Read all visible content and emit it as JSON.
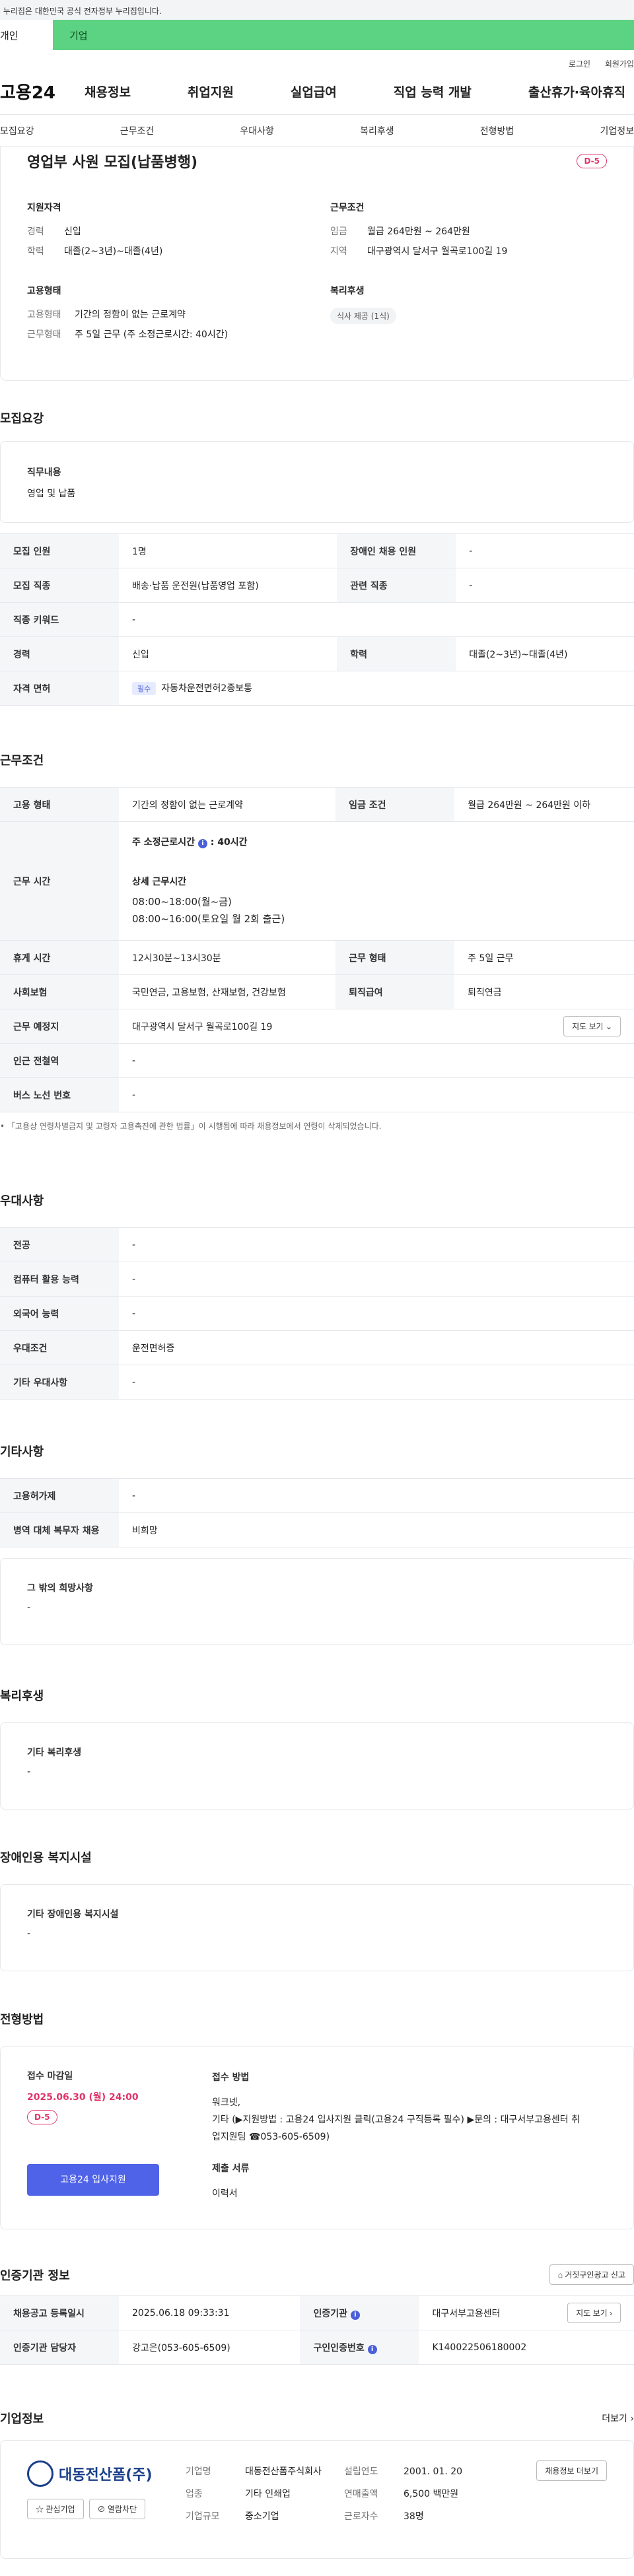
{
  "gov_banner": "이 누리집은 대한민국 공식 전자정부 누리집입니다.",
  "site_tabs": [
    "개인",
    "기업"
  ],
  "util_links": [
    "로그인",
    "회원가입"
  ],
  "logo": "고용24",
  "gnb": [
    "채용정보",
    "취업지원",
    "실업급여",
    "직업 능력 개발",
    "출산휴가·육아휴직"
  ],
  "anchor_tabs": [
    "모집요강",
    "근무조건",
    "우대사항",
    "복리후생",
    "전형방법",
    "기업정보"
  ],
  "summary": {
    "title": "영업부 사원 모집(납품병행)",
    "dday": "D-5",
    "qualify_h": "지원자격",
    "qualify": [
      {
        "k": "경력",
        "v": "신입"
      },
      {
        "k": "학력",
        "v": "대졸(2~3년)~대졸(4년)"
      }
    ],
    "cond_h": "근무조건",
    "cond": [
      {
        "k": "임금",
        "v": "월급 264만원 ~ 264만원"
      },
      {
        "k": "지역",
        "v": "대구광역시 달서구 월곡로100길 19"
      }
    ],
    "emp_h": "고용형태",
    "emp": [
      {
        "k": "고용형태",
        "v": "기간의 정함이 없는 근로계약"
      },
      {
        "k": "근무형태",
        "v": "주 5일 근무 (주 소정근로시간: 40시간)"
      }
    ],
    "welfare_h": "복리후생",
    "welfare_chip": "식사 제공 (1식)"
  },
  "recruit": {
    "title": "모집요강",
    "duty_h": "직무내용",
    "duty": "영업 및 납품",
    "rows": [
      {
        "k1": "모집 인원",
        "v1": "1명",
        "k2": "장애인 채용 인원",
        "v2": "-"
      },
      {
        "k1": "모집 직종",
        "v1": "배송·납품 운전원(납품영업 포함)",
        "k2": "관련 직종",
        "v2": "-"
      },
      {
        "k1": "직종 키워드",
        "v1": "-"
      },
      {
        "k1": "경력",
        "v1": "신입",
        "k2": "학력",
        "v2": "대졸(2~3년)~대졸(4년)"
      },
      {
        "k1": "자격 면허",
        "badge": "필수",
        "v1": "자동차운전면허2종보통"
      }
    ]
  },
  "work": {
    "title": "근무조건",
    "emp_type_k": "고용 형태",
    "emp_type_v": "기간의 정함이 없는 근로계약",
    "wage_k": "임금 조건",
    "wage_v": "월급 264만원 ~ 264만원 이하",
    "hours_k": "근무 시간",
    "hours_main": "주 소정근로시간",
    "hours_main_v": "40시간",
    "hours_detail_h": "상세 근무시간",
    "hours_detail": [
      "08:00~18:00(월~금)",
      "08:00~16:00(토요일 월 2회 출근)"
    ],
    "break_k": "휴게 시간",
    "break_v": "12시30분~13시30분",
    "form_k": "근무 형태",
    "form_v": "주 5일 근무",
    "ins_k": "사회보험",
    "ins_v": "국민연금, 고용보험, 산재보험, 건강보험",
    "ret_k": "퇴직급여",
    "ret_v": "퇴직연금",
    "place_k": "근무 예정지",
    "place_v": "대구광역시 달서구 월곡로100길 19",
    "map_btn": "지도 보기",
    "station_k": "인근 전철역",
    "station_v": "-",
    "bus_k": "버스 노선 번호",
    "bus_v": "-",
    "note": "「고용상 연령차별금지 및 고령자 고용촉진에 관한 법률」이 시행됨에 따라 채용정보에서 연령이 삭제되었습니다."
  },
  "pref": {
    "title": "우대사항",
    "rows": [
      {
        "k": "전공",
        "v": "-"
      },
      {
        "k": "컴퓨터 활용 능력",
        "v": "-"
      },
      {
        "k": "외국어 능력",
        "v": "-"
      },
      {
        "k": "우대조건",
        "v": "운전면허증"
      },
      {
        "k": "기타 우대사항",
        "v": "-"
      }
    ]
  },
  "etc": {
    "title": "기타사항",
    "rows": [
      {
        "k": "고용허가제",
        "v": "-"
      },
      {
        "k": "병역 대체 복무자 채용",
        "v": "비희망"
      }
    ],
    "hope_h": "그 밖의 희망사항",
    "hope_v": "-"
  },
  "welfare": {
    "title": "복리후생",
    "h": "기타 복리후생",
    "v": "-"
  },
  "disabled": {
    "title": "장애인용 복지시설",
    "h": "기타 장애인용 복지시설",
    "v": "-"
  },
  "process": {
    "title": "전형방법",
    "deadline_h": "접수 마감일",
    "deadline": "2025.06.30 (월) 24:00",
    "dday": "D-5",
    "apply_btn": "고용24 입사지원",
    "method_h": "접수 방법",
    "method": [
      "워크넷,",
      "기타 (▶지원방법 : 고용24 입사지원 클릭(고용24 구직등록 필수) ▶문의 : 대구서부고용센터 취",
      "업지원팀 ☎053-605-6509)"
    ],
    "docs_h": "제출 서류",
    "docs": "이력서"
  },
  "cert": {
    "title": "인증기관 정보",
    "report_btn": "거짓구인광고 신고",
    "reg_k": "채용공고 등록일시",
    "reg_v": "2025.06.18 09:33:31",
    "org_k": "인증기관",
    "org_v": "대구서부고용센터",
    "map_btn": "지도 보기",
    "mgr_k": "인증기관 담당자",
    "mgr_v": "강고은(053-605-6509)",
    "no_k": "구인인증번호",
    "no_v": "K140022506180002"
  },
  "company": {
    "title": "기업정보",
    "more": "더보기",
    "logo": "대동전산폼(주)",
    "fav_btn": "관심기업",
    "block_btn": "열람차단",
    "info_btn": "채용정보 더보기",
    "rows": [
      {
        "k": "기업명",
        "v": "대동전산폼주식회사"
      },
      {
        "k": "업종",
        "v": "기타 인쇄업"
      },
      {
        "k": "기업규모",
        "v": "중소기업"
      }
    ],
    "rows2": [
      {
        "k": "설립연도",
        "v": "2001. 01. 20"
      },
      {
        "k": "연매출액",
        "v": "6,500 백만원"
      },
      {
        "k": "근로자수",
        "v": "38명"
      }
    ]
  }
}
